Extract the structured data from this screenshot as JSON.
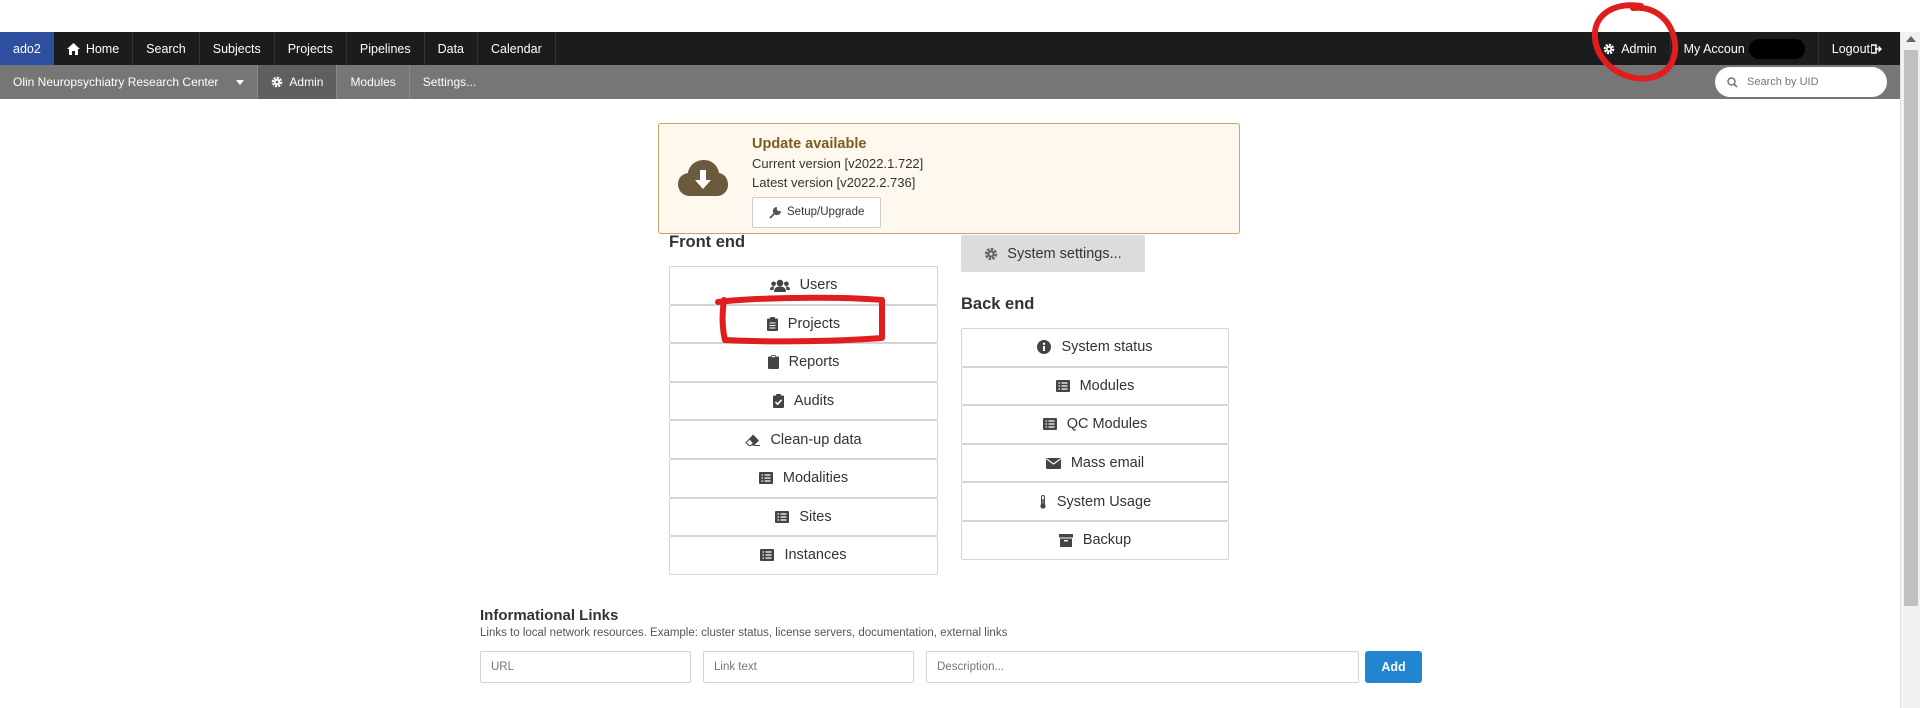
{
  "topbar": {
    "brand": "ado2",
    "items": [
      {
        "label": "Home",
        "icon": "home-icon"
      },
      {
        "label": "Search"
      },
      {
        "label": "Subjects"
      },
      {
        "label": "Projects"
      },
      {
        "label": "Pipelines"
      },
      {
        "label": "Data"
      },
      {
        "label": "Calendar"
      }
    ],
    "right": {
      "admin": "Admin",
      "my_account": "My Accoun",
      "logout": "Logout"
    }
  },
  "subbar": {
    "instance": "Olin Neuropsychiatry Research Center",
    "admin": "Admin",
    "modules": "Modules",
    "settings": "Settings...",
    "search_placeholder": "Search by UID"
  },
  "update": {
    "title": "Update available",
    "current": "Current version [v2022.1.722]",
    "latest": "Latest version [v2022.2.736]",
    "button": "Setup/Upgrade"
  },
  "frontend": {
    "title": "Front end",
    "buttons": [
      "Users",
      "Projects",
      "Reports",
      "Audits",
      "Clean-up data",
      "Modalities",
      "Sites",
      "Instances"
    ]
  },
  "backend": {
    "settings_button": "System settings...",
    "title": "Back end",
    "buttons": [
      "System status",
      "Modules",
      "QC Modules",
      "Mass email",
      "System Usage",
      "Backup"
    ]
  },
  "links": {
    "title": "Informational Links",
    "subtitle": "Links to local network resources. Example: cluster status, license servers, documentation, external links",
    "url_placeholder": "URL",
    "text_placeholder": "Link text",
    "desc_placeholder": "Description...",
    "add_label": "Add"
  },
  "colors": {
    "annotation": "#e01e1e",
    "brand": "#2e4e9e",
    "add_button": "#2185d0"
  }
}
